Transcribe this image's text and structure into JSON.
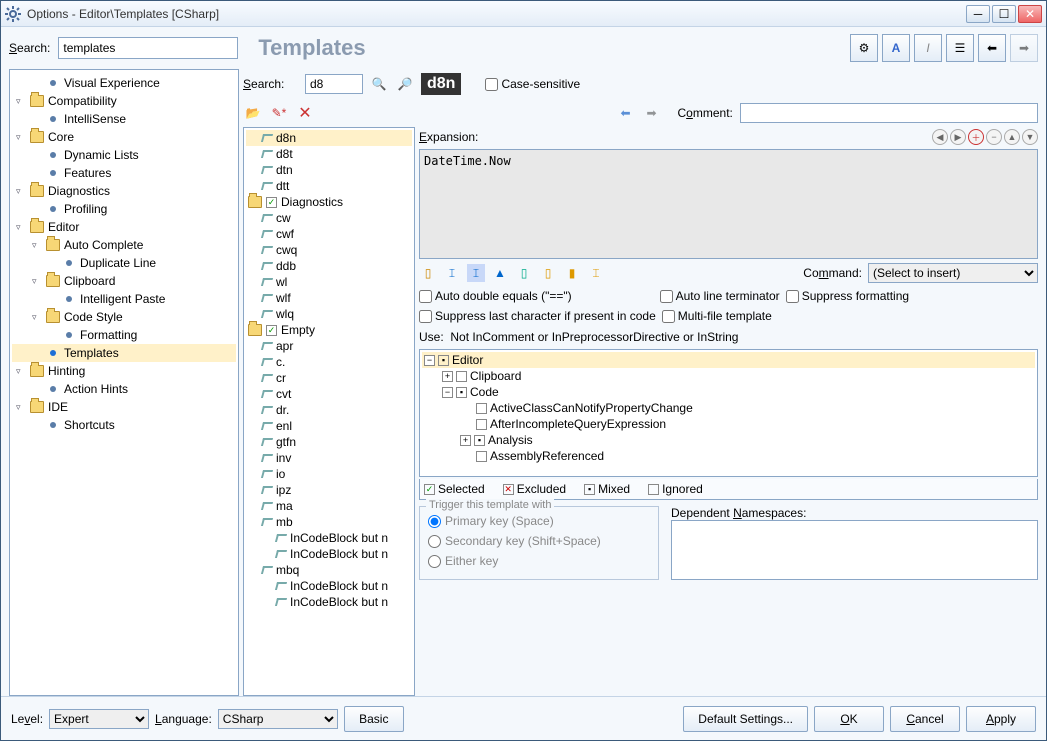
{
  "window_title": "Options - Editor\\Templates [CSharp]",
  "search_label": "Search:",
  "search_value": "templates",
  "page_title": "Templates",
  "nav": [
    {
      "indent": 1,
      "bullet": true,
      "label": "Visual Experience"
    },
    {
      "indent": 0,
      "exp": "▿",
      "folder": true,
      "label": "Compatibility"
    },
    {
      "indent": 1,
      "bullet": true,
      "label": "IntelliSense"
    },
    {
      "indent": 0,
      "exp": "▿",
      "folder": true,
      "label": "Core"
    },
    {
      "indent": 1,
      "bullet": true,
      "label": "Dynamic Lists"
    },
    {
      "indent": 1,
      "bullet": true,
      "label": "Features"
    },
    {
      "indent": 0,
      "exp": "▿",
      "folder": true,
      "label": "Diagnostics"
    },
    {
      "indent": 1,
      "bullet": true,
      "label": "Profiling"
    },
    {
      "indent": 0,
      "exp": "▿",
      "folder": true,
      "label": "Editor"
    },
    {
      "indent": 1,
      "exp": "▿",
      "folder": true,
      "label": "Auto Complete"
    },
    {
      "indent": 2,
      "bullet": true,
      "label": "Duplicate Line"
    },
    {
      "indent": 1,
      "exp": "▿",
      "folder": true,
      "label": "Clipboard"
    },
    {
      "indent": 2,
      "bullet": true,
      "label": "Intelligent Paste"
    },
    {
      "indent": 1,
      "exp": "▿",
      "folder": true,
      "label": "Code Style"
    },
    {
      "indent": 2,
      "bullet": true,
      "label": "Formatting"
    },
    {
      "indent": 1,
      "bullet": true,
      "blue": true,
      "label": "Templates",
      "selected": true
    },
    {
      "indent": 0,
      "exp": "▿",
      "folder": true,
      "label": "Hinting"
    },
    {
      "indent": 1,
      "bullet": true,
      "label": "Action Hints"
    },
    {
      "indent": 0,
      "exp": "▿",
      "folder": true,
      "label": "IDE"
    },
    {
      "indent": 1,
      "bullet": true,
      "label": "Shortcuts"
    }
  ],
  "tmpl_search_label": "Search:",
  "tmpl_search_value": "d8",
  "badge": "d8n",
  "case_sensitive": "Case-sensitive",
  "comment_label": "Comment:",
  "comment_value": "",
  "templates": [
    {
      "type": "tmpl",
      "label": "d8n",
      "indent": 1,
      "selected": true
    },
    {
      "type": "tmpl",
      "label": "d8t",
      "indent": 1
    },
    {
      "type": "tmpl",
      "label": "dtn",
      "indent": 1
    },
    {
      "type": "tmpl",
      "label": "dtt",
      "indent": 1
    },
    {
      "type": "folder",
      "label": "Diagnostics",
      "indent": 0,
      "check": true
    },
    {
      "type": "tmpl",
      "label": "cw",
      "indent": 1
    },
    {
      "type": "tmpl",
      "label": "cwf",
      "indent": 1
    },
    {
      "type": "tmpl",
      "label": "cwq",
      "indent": 1
    },
    {
      "type": "tmpl",
      "label": "ddb",
      "indent": 1
    },
    {
      "type": "tmpl",
      "label": "wl",
      "indent": 1
    },
    {
      "type": "tmpl",
      "label": "wlf",
      "indent": 1
    },
    {
      "type": "tmpl",
      "label": "wlq",
      "indent": 1
    },
    {
      "type": "folder",
      "label": "Empty",
      "indent": 0,
      "check": true
    },
    {
      "type": "tmpl",
      "label": "apr",
      "indent": 1
    },
    {
      "type": "tmpl",
      "label": "c.",
      "indent": 1
    },
    {
      "type": "tmpl",
      "label": "cr",
      "indent": 1
    },
    {
      "type": "tmpl",
      "label": "cvt",
      "indent": 1
    },
    {
      "type": "tmpl",
      "label": "dr.",
      "indent": 1
    },
    {
      "type": "tmpl",
      "label": "enl",
      "indent": 1
    },
    {
      "type": "tmpl",
      "label": "gtfn",
      "indent": 1
    },
    {
      "type": "tmpl",
      "label": "inv",
      "indent": 1
    },
    {
      "type": "tmpl",
      "label": "io",
      "indent": 1
    },
    {
      "type": "tmpl",
      "label": "ipz",
      "indent": 1
    },
    {
      "type": "tmpl",
      "label": "ma",
      "indent": 1
    },
    {
      "type": "tmpl",
      "label": "mb",
      "indent": 1
    },
    {
      "type": "tmpl",
      "label": "InCodeBlock but n",
      "indent": 2
    },
    {
      "type": "tmpl",
      "label": "InCodeBlock but n",
      "indent": 2
    },
    {
      "type": "tmpl",
      "label": "mbq",
      "indent": 1
    },
    {
      "type": "tmpl",
      "label": "InCodeBlock but n",
      "indent": 2
    },
    {
      "type": "tmpl",
      "label": "InCodeBlock but n",
      "indent": 2
    }
  ],
  "expansion_label": "Expansion:",
  "expansion_text": "DateTime.Now",
  "command_label": "Command:",
  "command_value": "(Select to insert)",
  "checkboxes": {
    "auto_double": "Auto double equals (\"==\")",
    "auto_line": "Auto line terminator",
    "suppress_fmt": "Suppress formatting",
    "suppress_last": "Suppress last character if present in code",
    "multi_file": "Multi-file template"
  },
  "use_label": "Use:",
  "use_value": "Not InComment or InPreprocessorDirective or InString",
  "context_tree": [
    {
      "indent": 0,
      "exp": "−",
      "check": "▪",
      "label": "Editor",
      "selected": true
    },
    {
      "indent": 1,
      "exp": "+",
      "check": "",
      "label": "Clipboard"
    },
    {
      "indent": 1,
      "exp": "−",
      "check": "▪",
      "label": "Code"
    },
    {
      "indent": 2,
      "check": "",
      "label": "ActiveClassCanNotifyPropertyChange"
    },
    {
      "indent": 2,
      "check": "",
      "label": "AfterIncompleteQueryExpression"
    },
    {
      "indent": 2,
      "exp": "+",
      "check": "▪",
      "label": "Analysis"
    },
    {
      "indent": 2,
      "check": "",
      "label": "AssemblyReferenced"
    }
  ],
  "legend": {
    "selected": "Selected",
    "excluded": "Excluded",
    "mixed": "Mixed",
    "ignored": "Ignored"
  },
  "trigger": {
    "title": "Trigger this template with",
    "primary": "Primary key (Space)",
    "secondary": "Secondary key (Shift+Space)",
    "either": "Either key"
  },
  "dep_label": "Dependent Namespaces:",
  "footer": {
    "level_label": "Level:",
    "level_value": "Expert",
    "lang_label": "Language:",
    "lang_value": "CSharp",
    "basic": "Basic",
    "defaults": "Default Settings...",
    "ok": "OK",
    "cancel": "Cancel",
    "apply": "Apply"
  }
}
